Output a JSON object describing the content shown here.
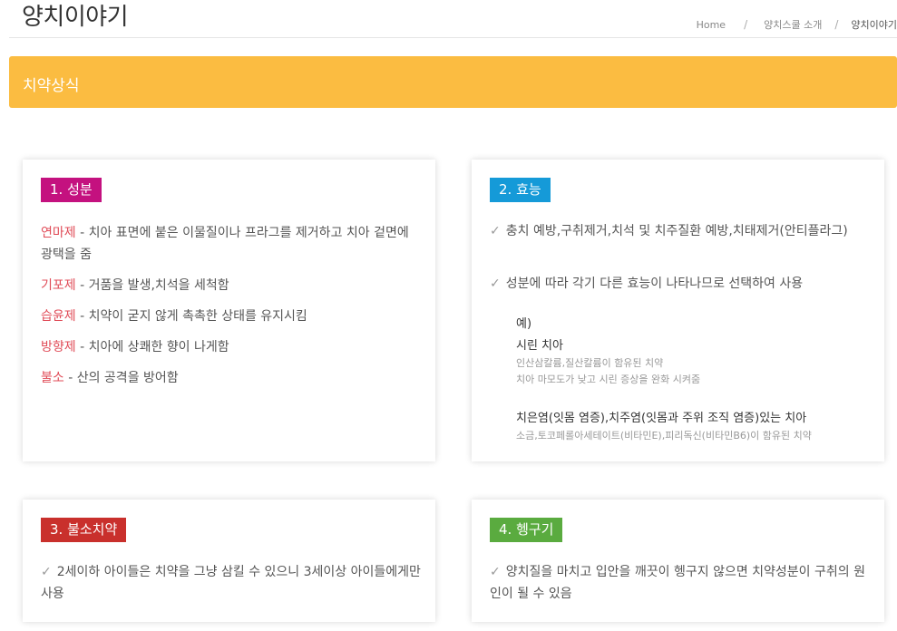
{
  "header": {
    "title": "양치이야기",
    "breadcrumb": [
      "Home",
      "양치스쿨 소개",
      "양치이야기"
    ]
  },
  "banner": {
    "title": "치약상식"
  },
  "cards": {
    "ingredients": {
      "tag": "1. 성분",
      "tag_color": "#c4117f",
      "items": [
        {
          "term": "연마제",
          "desc": " - 치아 표면에 붙은 이물질이나 프라그를 제거하고 치아 겉면에 광택을 줌"
        },
        {
          "term": "기포제",
          "desc": " - 거품을 발생,치석을 세척함"
        },
        {
          "term": "습윤제",
          "desc": " - 치약이 굳지 않게 촉촉한 상태를 유지시킴"
        },
        {
          "term": "방향제",
          "desc": " - 치아에 상쾌한 향이 나게함"
        },
        {
          "term": "불소",
          "desc": " - 산의 공격을 방어함"
        }
      ]
    },
    "effects": {
      "tag": "2. 효능",
      "tag_color": "#159ad8",
      "items": [
        "충치 예방,구취제거,치석 및 치주질환 예방,치태제거(안티플라그)",
        "성분에 따라 각기 다른 효능이 나타나므로 선택하여 사용"
      ],
      "example": {
        "label": "예)",
        "groups": [
          {
            "title": "시린 치아",
            "lines": [
              "인산삼칼륨,질산칼륨이 함유된 치약",
              "치아 마모도가 낮고 시린 증상을 완화 시켜줌"
            ]
          },
          {
            "title": "치은염(잇몸 염증),치주염(잇몸과 주위 조직 염증)있는 치아",
            "lines": [
              "소금,토코페롤아세테이트(비타민E),피리독신(비타민B6)이 함유된 치약"
            ]
          }
        ]
      }
    },
    "fluoride": {
      "tag": "3. 불소치약",
      "tag_color": "#c9302c",
      "items": [
        "2세이하 아이들은 치약을 그냥 삼킬 수 있으니 3세이상 아이들에게만 사용"
      ]
    },
    "rinse": {
      "tag": "4. 헹구기",
      "tag_color": "#5aab3f",
      "items": [
        "양치질을 마치고 입안을 깨끗이 헹구지 않으면 치약성분이 구취의 원인이 될 수 있음"
      ]
    }
  },
  "icons": {
    "check": "✓"
  },
  "colors": {
    "banner": "#fbbc41",
    "term": "#e04b57"
  }
}
